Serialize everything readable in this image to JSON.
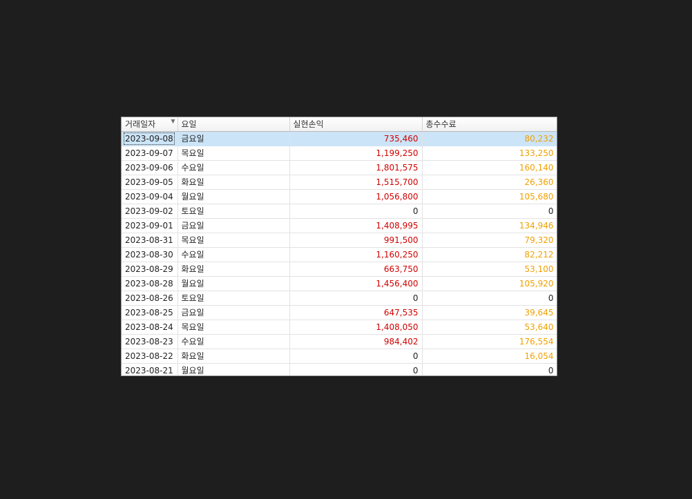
{
  "table": {
    "columns": [
      "거래일자",
      "요일",
      "실현손익",
      "총수수료"
    ],
    "sort_icon": "sort-desc-icon",
    "colors": {
      "profit": "#d10000",
      "fee": "#f0a000",
      "selected_row": "#cce4f7"
    },
    "selected_row_index": 0,
    "rows": [
      {
        "date": "2023-09-08",
        "day": "금요일",
        "profit": "735,460",
        "fee": "80,232"
      },
      {
        "date": "2023-09-07",
        "day": "목요일",
        "profit": "1,199,250",
        "fee": "133,250"
      },
      {
        "date": "2023-09-06",
        "day": "수요일",
        "profit": "1,801,575",
        "fee": "160,140"
      },
      {
        "date": "2023-09-05",
        "day": "화요일",
        "profit": "1,515,700",
        "fee": "26,360"
      },
      {
        "date": "2023-09-04",
        "day": "월요일",
        "profit": "1,056,800",
        "fee": "105,680"
      },
      {
        "date": "2023-09-02",
        "day": "토요일",
        "profit": "0",
        "fee": "0"
      },
      {
        "date": "2023-09-01",
        "day": "금요일",
        "profit": "1,408,995",
        "fee": "134,946"
      },
      {
        "date": "2023-08-31",
        "day": "목요일",
        "profit": "991,500",
        "fee": "79,320"
      },
      {
        "date": "2023-08-30",
        "day": "수요일",
        "profit": "1,160,250",
        "fee": "82,212"
      },
      {
        "date": "2023-08-29",
        "day": "화요일",
        "profit": "663,750",
        "fee": "53,100"
      },
      {
        "date": "2023-08-28",
        "day": "월요일",
        "profit": "1,456,400",
        "fee": "105,920"
      },
      {
        "date": "2023-08-26",
        "day": "토요일",
        "profit": "0",
        "fee": "0"
      },
      {
        "date": "2023-08-25",
        "day": "금요일",
        "profit": "647,535",
        "fee": "39,645"
      },
      {
        "date": "2023-08-24",
        "day": "목요일",
        "profit": "1,408,050",
        "fee": "53,640"
      },
      {
        "date": "2023-08-23",
        "day": "수요일",
        "profit": "984,402",
        "fee": "176,554"
      },
      {
        "date": "2023-08-22",
        "day": "화요일",
        "profit": "0",
        "fee": "16,054"
      },
      {
        "date": "2023-08-21",
        "day": "월요일",
        "profit": "0",
        "fee": "0"
      }
    ]
  }
}
